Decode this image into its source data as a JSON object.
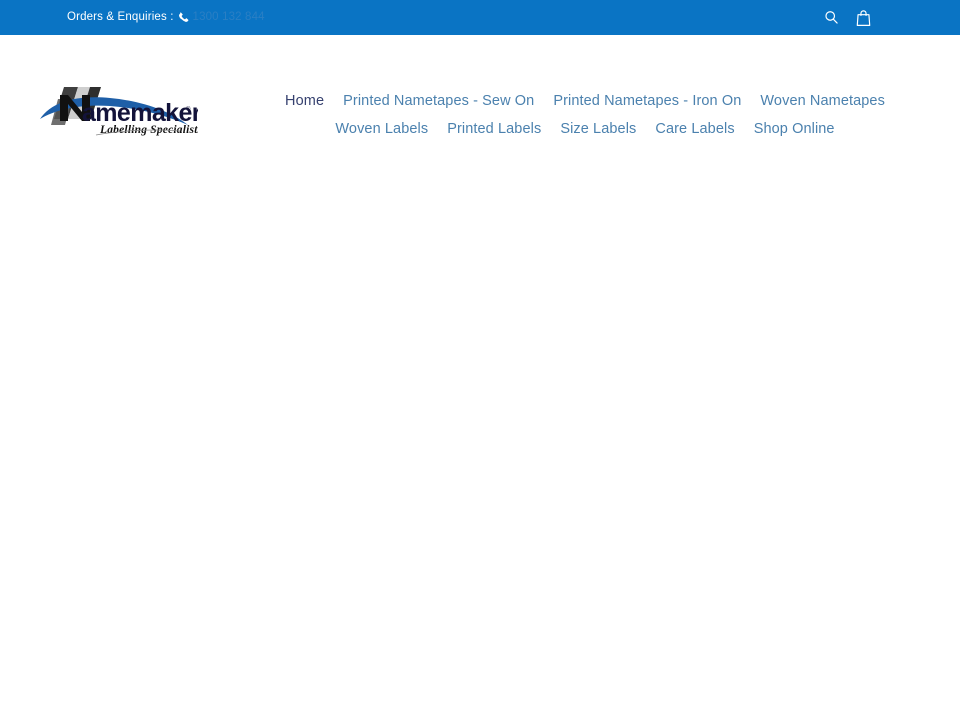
{
  "topbar": {
    "message": "Orders & Enquiries :",
    "phone": "1300 132 844",
    "phone_icon": "phone-icon",
    "search_icon": "search-icon",
    "cart_icon": "shopping-bag-icon",
    "background_color": "#0a74c4",
    "text_color": "#ffffff",
    "phone_link_color": "#2a7fc4"
  },
  "logo": {
    "wordmark": "Namemakers",
    "trademark": "®",
    "tagline": "Labelling Specialists",
    "mark_colors": {
      "swoosh": "#1e5fa8",
      "letter": "#1a1a1a",
      "blocks_dark": "#3a3a3a",
      "blocks_light": "#d8d8d8"
    }
  },
  "nav": {
    "items": [
      {
        "label": "Home",
        "active": true
      },
      {
        "label": "Printed Nametapes - Sew On",
        "active": false
      },
      {
        "label": "Printed Nametapes - Iron On",
        "active": false
      },
      {
        "label": "Woven Nametapes",
        "active": false
      },
      {
        "label": "Woven Labels",
        "active": false
      },
      {
        "label": "Printed Labels",
        "active": false
      },
      {
        "label": "Size Labels",
        "active": false
      },
      {
        "label": "Care Labels",
        "active": false
      },
      {
        "label": "Shop Online",
        "active": false
      }
    ],
    "link_color": "#4b81ae",
    "active_color": "#36416f"
  },
  "main": {
    "content": "",
    "background_color": "#ffffff"
  }
}
